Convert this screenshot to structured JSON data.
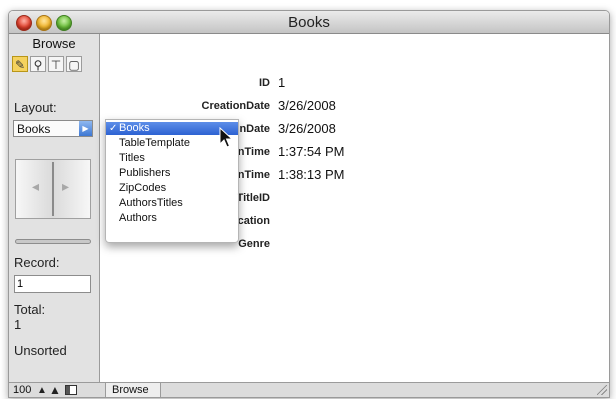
{
  "window": {
    "title": "Books"
  },
  "status_area": {
    "mode": "Browse",
    "layout_label": "Layout:",
    "layout_value": "Books",
    "record_label": "Record:",
    "record_value": "1",
    "total_label": "Total:",
    "total_value": "1",
    "sort_status": "Unsorted"
  },
  "tools": [
    {
      "name": "browse-tool",
      "icon": "pencil-icon"
    },
    {
      "name": "find-tool",
      "icon": "magnifier-icon"
    },
    {
      "name": "layout-tool",
      "icon": "t-square-icon"
    },
    {
      "name": "preview-tool",
      "icon": "page-icon"
    }
  ],
  "fields": [
    {
      "label": "ID",
      "value": "1"
    },
    {
      "label": "CreationDate",
      "value": "3/26/2008"
    },
    {
      "label": "nDate",
      "value": "3/26/2008"
    },
    {
      "label": "nTime",
      "value": "1:37:54 PM"
    },
    {
      "label": "nTime",
      "value": "1:38:13 PM"
    },
    {
      "label": "TitleID",
      "value": ""
    },
    {
      "label": "cation",
      "value": ""
    },
    {
      "label": "Genre",
      "value": ""
    }
  ],
  "layout_menu": {
    "items": [
      "Books",
      "TableTemplate",
      "Titles",
      "Publishers",
      "ZipCodes",
      "AuthorsTitles",
      "Authors"
    ],
    "selected": "Books",
    "check_mark": "✓"
  },
  "bottom_bar": {
    "zoom": "100",
    "mode": "Browse"
  },
  "colors": {
    "selection": "#3a6fd8",
    "tool_active": "#f5d25e"
  }
}
